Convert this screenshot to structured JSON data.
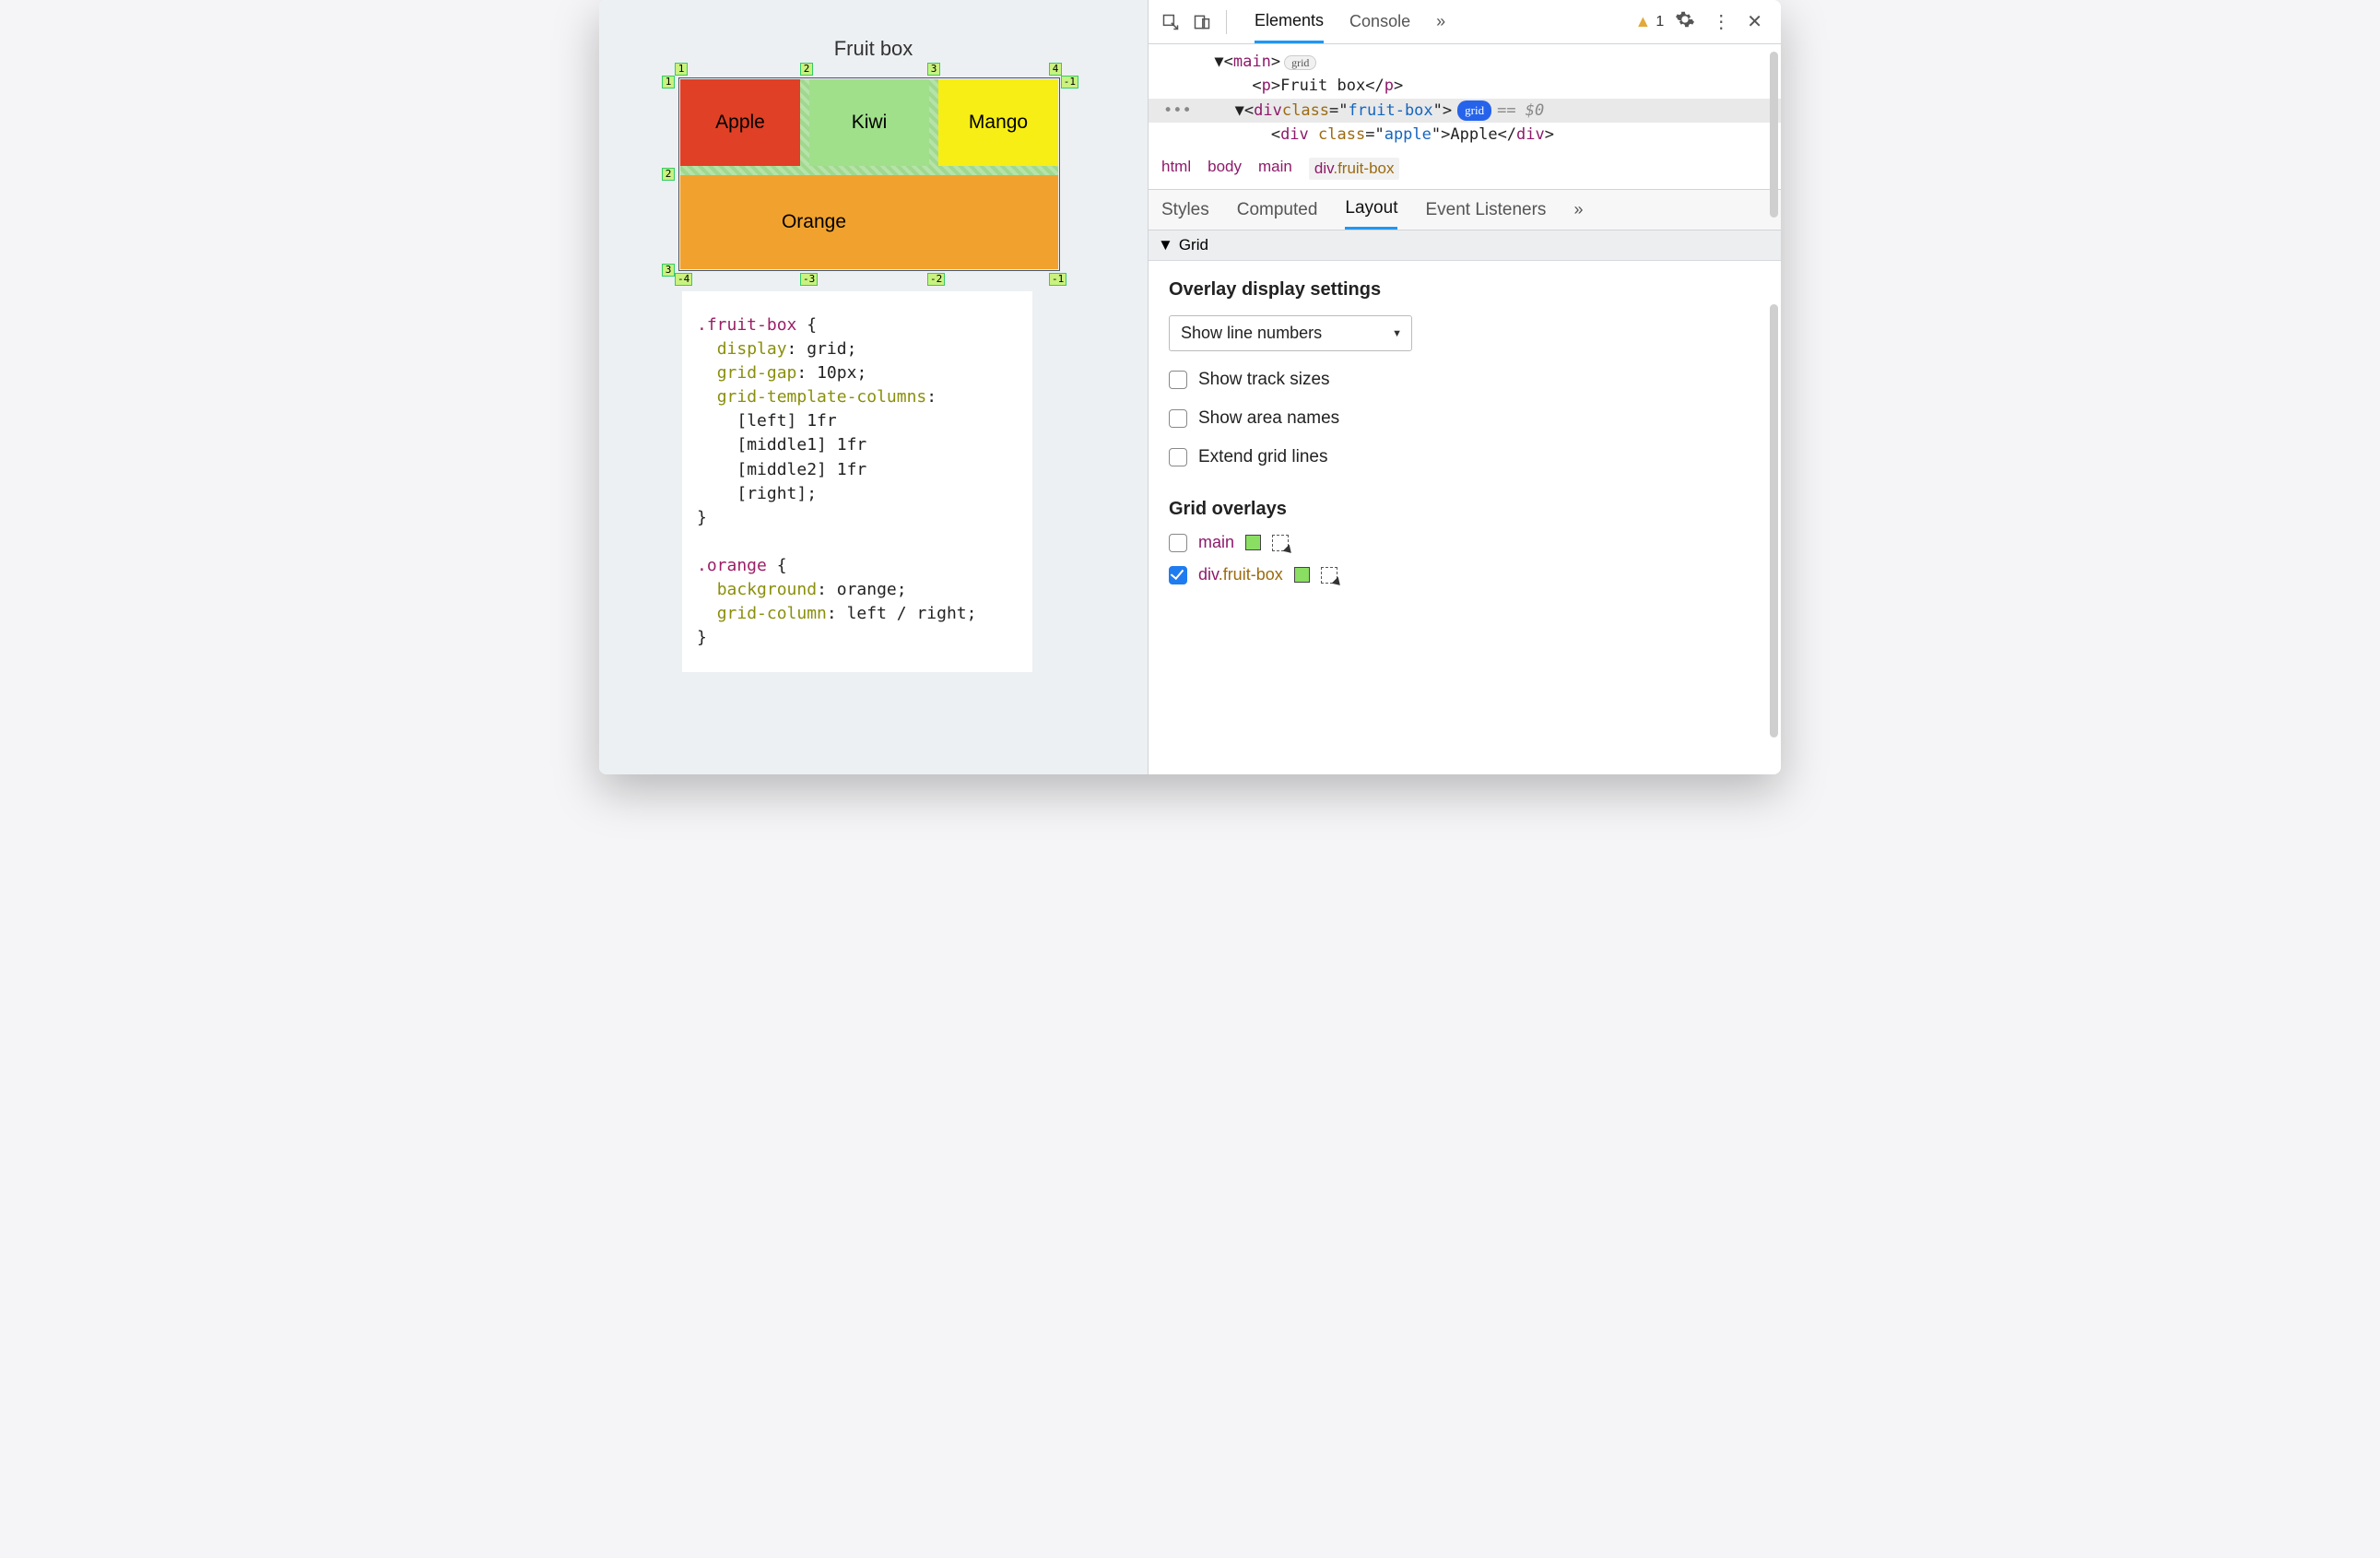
{
  "page": {
    "title": "Fruit box",
    "cells": {
      "apple": "Apple",
      "kiwi": "Kiwi",
      "mango": "Mango",
      "orange": "Orange"
    },
    "grid_tags": {
      "top": [
        "1",
        "2",
        "3",
        "4"
      ],
      "left": [
        "1",
        "2",
        "3"
      ],
      "right": [
        "-1"
      ],
      "bottom": [
        "-4",
        "-3",
        "-2",
        "-1"
      ]
    },
    "css": {
      "rule1_selector": ".fruit-box",
      "rule1_props": [
        {
          "p": "display",
          "v": "grid"
        },
        {
          "p": "grid-gap",
          "v": "10px"
        },
        {
          "p": "grid-template-columns",
          "v_lines": [
            "[left] 1fr",
            "[middle1] 1fr",
            "[middle2] 1fr",
            "[right]"
          ]
        }
      ],
      "rule2_selector": ".orange",
      "rule2_props": [
        {
          "p": "background",
          "v": "orange"
        },
        {
          "p": "grid-column",
          "v": "left / right"
        }
      ]
    }
  },
  "devtools": {
    "main_tabs": {
      "elements": "Elements",
      "console": "Console",
      "more": "»"
    },
    "warning_count": "1",
    "dom": {
      "line1_tag": "main",
      "line1_badge": "grid",
      "line2_tag_open": "p",
      "line2_text": "Fruit box",
      "line2_tag_close": "p",
      "line3_tag": "div",
      "line3_attr": "class",
      "line3_val": "fruit-box",
      "line3_badge": "grid",
      "line3_eq": "== $0",
      "line4_tag_open": "div",
      "line4_attr": "class",
      "line4_val": "apple",
      "line4_text": "Apple",
      "line4_tag_close": "div"
    },
    "breadcrumbs": [
      {
        "t": "html"
      },
      {
        "t": "body"
      },
      {
        "t": "main"
      },
      {
        "t": "div",
        "cls": ".fruit-box",
        "active": true
      }
    ],
    "subtabs": {
      "styles": "Styles",
      "computed": "Computed",
      "layout": "Layout",
      "events": "Event Listeners",
      "more": "»"
    },
    "grid_section": {
      "title": "Grid",
      "overlay_heading": "Overlay display settings",
      "select_value": "Show line numbers",
      "checks": [
        {
          "label": "Show track sizes",
          "checked": false
        },
        {
          "label": "Show area names",
          "checked": false
        },
        {
          "label": "Extend grid lines",
          "checked": false
        }
      ],
      "overlays_heading": "Grid overlays",
      "overlays": [
        {
          "name": "main",
          "cls": "",
          "checked": false,
          "swatch": "#8ade62"
        },
        {
          "name": "div",
          "cls": ".fruit-box",
          "checked": true,
          "swatch": "#8ade62"
        }
      ]
    }
  }
}
